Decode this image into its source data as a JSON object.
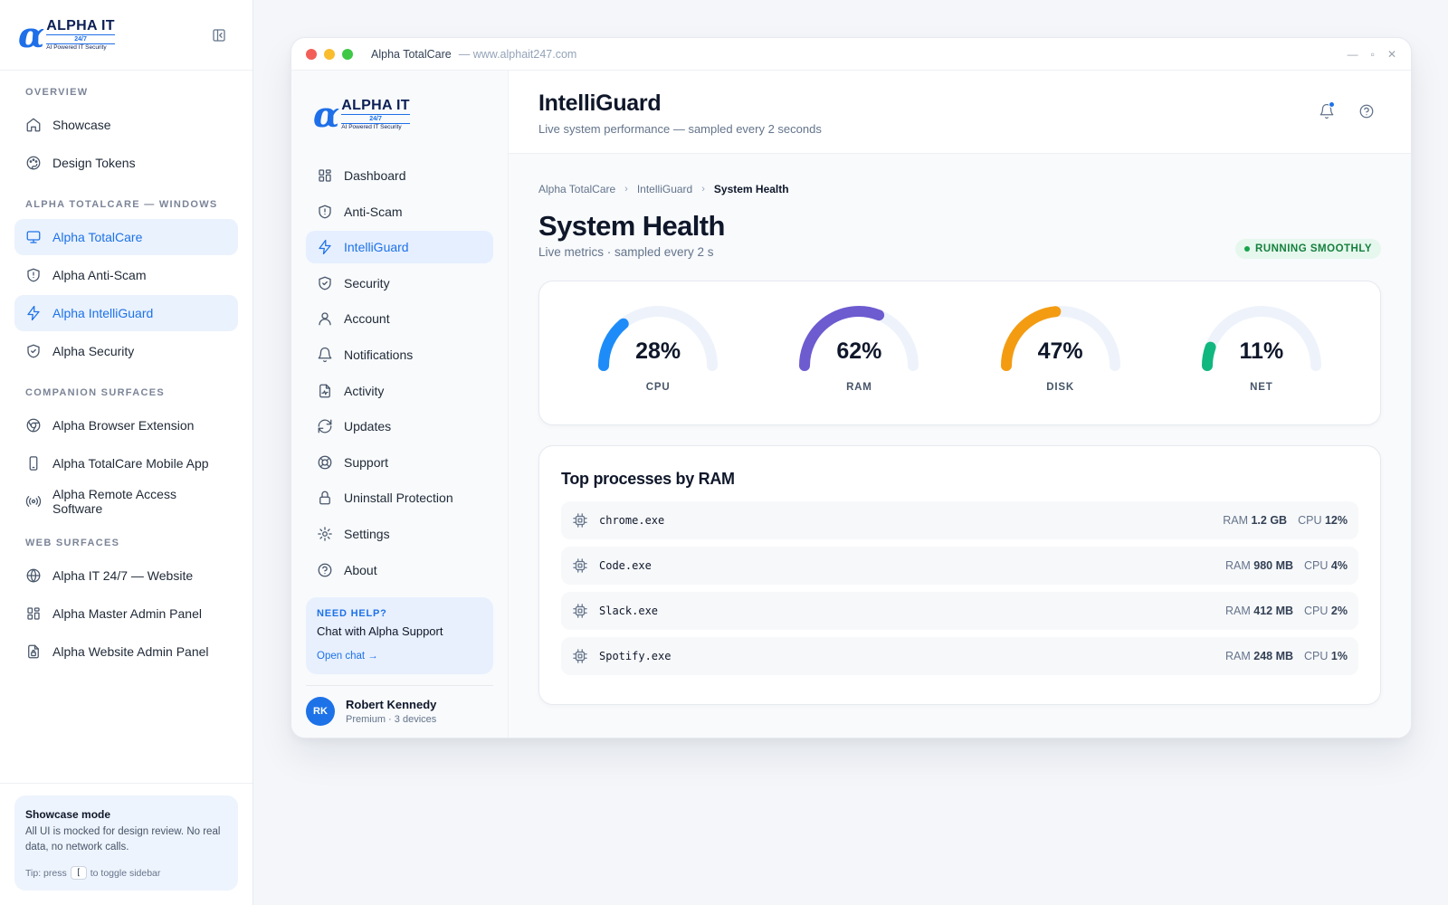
{
  "logo": {
    "mark": "α",
    "line1": "ALPHA IT",
    "line2": "24/7",
    "line3": "AI Powered IT Security"
  },
  "outer_sidebar": {
    "sections": [
      {
        "label": "OVERVIEW",
        "items": [
          {
            "label": "Showcase",
            "icon": "home-icon",
            "active": false
          },
          {
            "label": "Design Tokens",
            "icon": "palette-icon",
            "active": false
          }
        ]
      },
      {
        "label": "ALPHA TOTALCARE — WINDOWS",
        "items": [
          {
            "label": "Alpha TotalCare",
            "icon": "monitor-icon",
            "active": true
          },
          {
            "label": "Alpha Anti-Scam",
            "icon": "shield-alert-icon",
            "active": false
          },
          {
            "label": "Alpha IntelliGuard",
            "icon": "zap-icon",
            "active": true
          },
          {
            "label": "Alpha Security",
            "icon": "shield-check-icon",
            "active": false
          }
        ]
      },
      {
        "label": "COMPANION SURFACES",
        "items": [
          {
            "label": "Alpha Browser Extension",
            "icon": "chrome-icon",
            "active": false
          },
          {
            "label": "Alpha TotalCare Mobile App",
            "icon": "smartphone-icon",
            "active": false
          },
          {
            "label": "Alpha Remote Access Software",
            "icon": "radio-icon",
            "active": false
          }
        ]
      },
      {
        "label": "WEB SURFACES",
        "items": [
          {
            "label": "Alpha IT 24/7 — Website",
            "icon": "globe-icon",
            "active": false
          },
          {
            "label": "Alpha Master Admin Panel",
            "icon": "grid-icon",
            "active": false
          },
          {
            "label": "Alpha Website Admin Panel",
            "icon": "file-lock-icon",
            "active": false
          }
        ]
      }
    ],
    "showcase": {
      "title": "Showcase mode",
      "body": "All UI is mocked for design review. No real data, no network calls.",
      "tip_prefix": "Tip: press",
      "tip_key": "[",
      "tip_suffix": "to toggle sidebar"
    }
  },
  "window": {
    "title": "Alpha TotalCare",
    "url": "— www.alphait247.com",
    "controls": {
      "minimize": "—",
      "maximize": "▫",
      "close": "✕"
    }
  },
  "app_sidebar": {
    "items": [
      {
        "label": "Dashboard",
        "icon": "grid-icon",
        "active": false
      },
      {
        "label": "Anti-Scam",
        "icon": "shield-alert-icon",
        "active": false
      },
      {
        "label": "IntelliGuard",
        "icon": "zap-icon",
        "active": true
      },
      {
        "label": "Security",
        "icon": "shield-check-icon",
        "active": false
      },
      {
        "label": "Account",
        "icon": "user-icon",
        "active": false
      },
      {
        "label": "Notifications",
        "icon": "bell-icon",
        "active": false
      },
      {
        "label": "Activity",
        "icon": "file-activity-icon",
        "active": false
      },
      {
        "label": "Updates",
        "icon": "refresh-icon",
        "active": false
      },
      {
        "label": "Support",
        "icon": "life-buoy-icon",
        "active": false
      },
      {
        "label": "Uninstall Protection",
        "icon": "lock-icon",
        "active": false
      },
      {
        "label": "Settings",
        "icon": "gear-icon",
        "active": false
      },
      {
        "label": "About",
        "icon": "help-circle-icon",
        "active": false
      }
    ],
    "help": {
      "label": "NEED HELP?",
      "title": "Chat with Alpha Support",
      "link": "Open chat →"
    },
    "user": {
      "initials": "RK",
      "name": "Robert Kennedy",
      "sub": "Premium · 3 devices"
    }
  },
  "header": {
    "title": "IntelliGuard",
    "subtitle": "Live system performance — sampled every 2 seconds"
  },
  "breadcrumb": [
    "Alpha TotalCare",
    "IntelliGuard",
    "System Health"
  ],
  "page": {
    "title": "System Health",
    "subtitle": "Live metrics · sampled every 2 s",
    "status": "RUNNING SMOOTHLY"
  },
  "gauges": [
    {
      "label": "CPU",
      "value": 28,
      "display": "28%",
      "color": "#1d8cf8"
    },
    {
      "label": "RAM",
      "value": 62,
      "display": "62%",
      "color": "#6d5bd0"
    },
    {
      "label": "DISK",
      "value": 47,
      "display": "47%",
      "color": "#f39c12"
    },
    {
      "label": "NET",
      "value": 11,
      "display": "11%",
      "color": "#10b77f"
    }
  ],
  "processes": {
    "title": "Top processes by RAM",
    "ram_label": "RAM",
    "cpu_label": "CPU",
    "rows": [
      {
        "name": "chrome.exe",
        "ram": "1.2 GB",
        "cpu": "12%"
      },
      {
        "name": "Code.exe",
        "ram": "980 MB",
        "cpu": "4%"
      },
      {
        "name": "Slack.exe",
        "ram": "412 MB",
        "cpu": "2%"
      },
      {
        "name": "Spotify.exe",
        "ram": "248 MB",
        "cpu": "1%"
      }
    ]
  },
  "colors": {
    "accent": "#1d72e8",
    "success": "#16a34a",
    "track": "#eef3fb"
  }
}
